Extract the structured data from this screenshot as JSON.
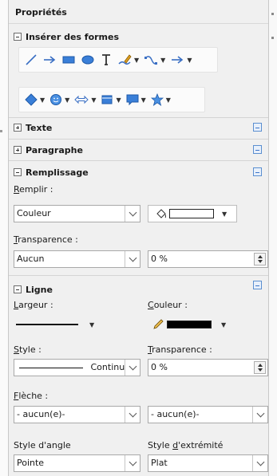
{
  "deck": {
    "title": "Propriétés"
  },
  "shapes": {
    "title": "Insérer des formes",
    "row1": [
      "line-icon",
      "arrow-icon",
      "rectangle-icon",
      "ellipse-icon",
      "text-icon",
      "freeform-icon",
      "curve-icon",
      "connector-icon"
    ],
    "row2": [
      "diamond-icon",
      "smiley-icon",
      "double-arrow-icon",
      "flowchart-icon",
      "callout-icon",
      "star-icon"
    ]
  },
  "text_section": {
    "title": "Texte"
  },
  "paragraph_section": {
    "title": "Paragraphe"
  },
  "fill": {
    "title": "Remplissage",
    "fill_label_pre": "",
    "fill_label_u": "R",
    "fill_label_post": "emplir :",
    "fill_value": "Couleur",
    "transparency_label_u": "T",
    "transparency_label_post": "ransparence :",
    "transparency_mode": "Aucun",
    "transparency_value": "0 %"
  },
  "line": {
    "title": "Ligne",
    "width_label_u": "L",
    "width_label_post": "argeur :",
    "color_label_u": "C",
    "color_label_post": "ouleur :",
    "style_label_u": "S",
    "style_label_post": "tyle :",
    "style_value": "Continu",
    "transparency_label_u": "T",
    "transparency_label_post": "ransparence :",
    "transparency_value": "0 %",
    "arrow_label_u": "F",
    "arrow_label_post": "lèche :",
    "arrow_start": "- aucun(e)-",
    "arrow_end": "- aucun(e)-",
    "corner_label_pre": "Style d'angle",
    "cap_label_pre": "Style ",
    "cap_label_u": "d",
    "cap_label_post": "'extrémité",
    "corner_value": "Pointe",
    "cap_value": "Plat"
  },
  "colors": {
    "accent": "#3d74c6",
    "fill_swatch": "#ffffff",
    "line_swatch": "#000000"
  }
}
